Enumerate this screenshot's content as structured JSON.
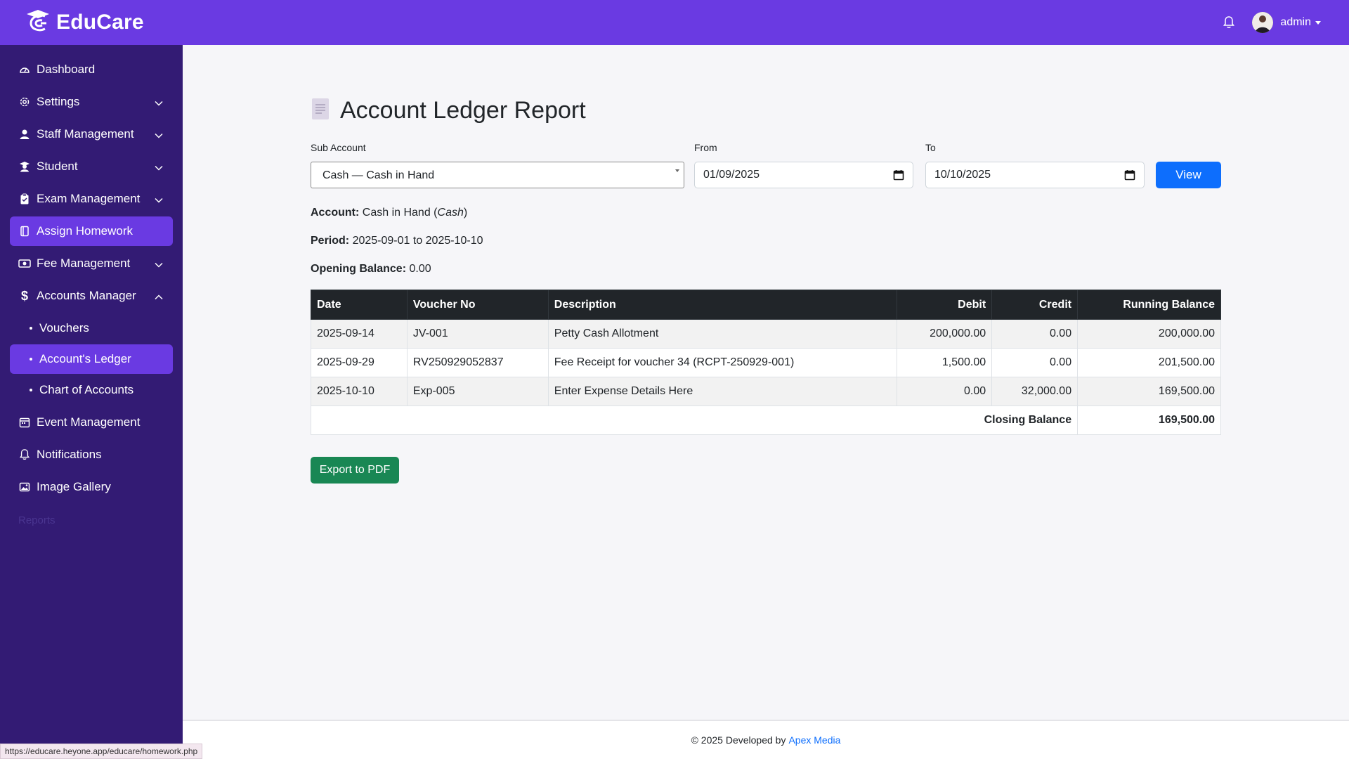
{
  "app": {
    "name": "EduCare"
  },
  "topbar": {
    "user": "admin"
  },
  "sidebar": {
    "items": [
      {
        "label": "Dashboard",
        "icon": "dashboard-gauge-icon"
      },
      {
        "label": "Settings",
        "icon": "gear-icon"
      },
      {
        "label": "Staff Management",
        "icon": "user-icon"
      },
      {
        "label": "Student",
        "icon": "student-icon"
      },
      {
        "label": "Exam Management",
        "icon": "clipboard-icon"
      },
      {
        "label": "Assign Homework",
        "icon": "book-icon"
      },
      {
        "label": "Fee Management",
        "icon": "money-icon"
      },
      {
        "label": "Accounts Manager",
        "icon": "dollar-icon"
      },
      {
        "label": "Event Management",
        "icon": "calendar-icon"
      },
      {
        "label": "Notifications",
        "icon": "bell-icon"
      },
      {
        "label": "Image Gallery",
        "icon": "image-icon"
      }
    ],
    "sub_items": [
      "Vouchers",
      "Account's Ledger",
      "Chart of Accounts"
    ],
    "faded": "Reports"
  },
  "page": {
    "title": "Account Ledger Report",
    "filters": {
      "sub_account_label": "Sub Account",
      "sub_account_value": "Cash — Cash in Hand",
      "from_label": "From",
      "from_value": "01/09/2025",
      "to_label": "To",
      "to_value": "10/10/2025",
      "view_button": "View"
    },
    "summary": {
      "account_label": "Account:",
      "account_value": "Cash in Hand",
      "account_code": "Cash",
      "period_label": "Period:",
      "period_value": "2025-09-01 to 2025-10-10",
      "opening_label": "Opening Balance:",
      "opening_value": "0.00"
    },
    "table": {
      "columns": [
        "Date",
        "Voucher No",
        "Description",
        "Debit",
        "Credit",
        "Running Balance"
      ],
      "rows": [
        [
          "2025-09-14",
          "JV-001",
          "Petty Cash Allotment",
          "200,000.00",
          "0.00",
          "200,000.00"
        ],
        [
          "2025-09-29",
          "RV250929052837",
          "Fee Receipt for voucher 34 (RCPT-250929-001)",
          "1,500.00",
          "0.00",
          "201,500.00"
        ],
        [
          "2025-10-10",
          "Exp-005",
          "Enter Expense Details Here",
          "0.00",
          "32,000.00",
          "169,500.00"
        ]
      ],
      "closing_label": "Closing Balance",
      "closing_value": "169,500.00"
    },
    "export_button": "Export to PDF"
  },
  "footer": {
    "text": "© 2025 Developed by",
    "link": "Apex Media"
  },
  "statusbar": {
    "url": "https://educare.heyone.app/educare/homework.php"
  },
  "colors": {
    "primary": "#6a3ae2",
    "sidebar": "#331b74",
    "view": "#0d6efd",
    "export": "#198754"
  }
}
